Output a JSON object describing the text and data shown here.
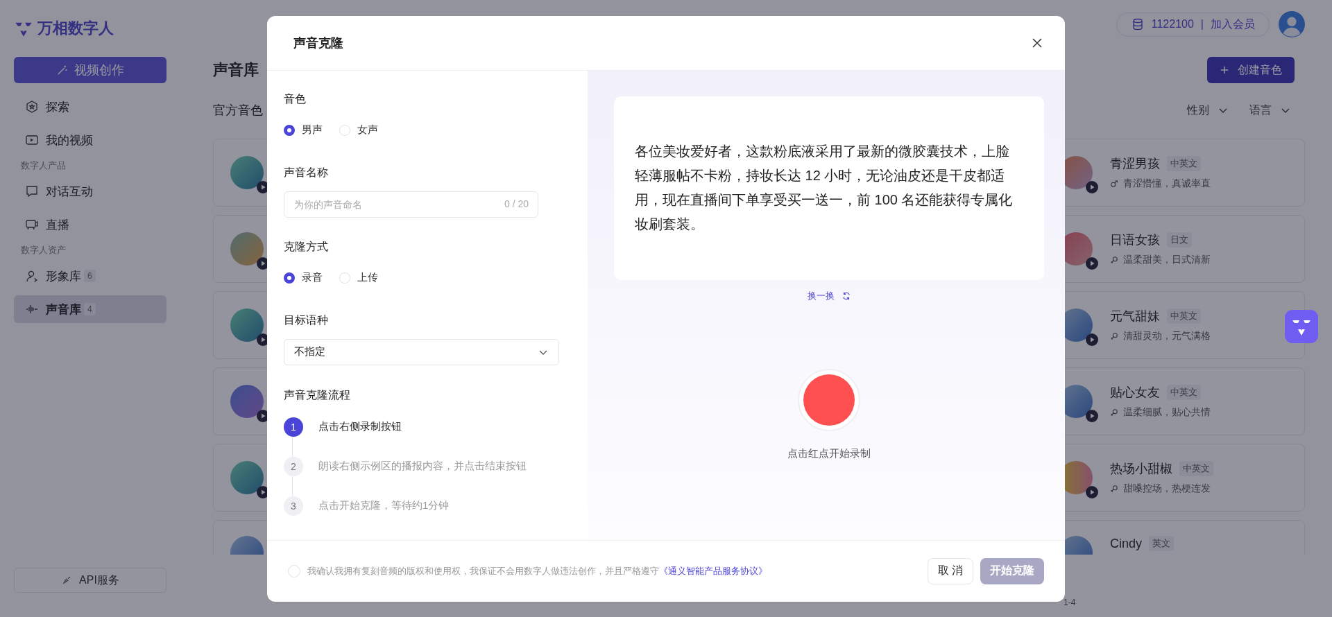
{
  "brand": {
    "name": "万相数字人"
  },
  "sidebar": {
    "create_button": "视频创作",
    "groups": [
      {
        "items": [
          {
            "label": "探索",
            "selected": false
          },
          {
            "label": "我的视频",
            "selected": false
          }
        ]
      },
      {
        "title": "数字人产品",
        "items": [
          {
            "label": "对话互动",
            "selected": false
          },
          {
            "label": "直播",
            "selected": false
          }
        ]
      },
      {
        "title": "数字人资产",
        "items": [
          {
            "label": "形象库",
            "badge": "6",
            "selected": false
          },
          {
            "label": "声音库",
            "badge": "4",
            "selected": true
          }
        ]
      }
    ],
    "api_button": "API服务"
  },
  "topbar": {
    "credits": "1122100",
    "separator": "|",
    "membership": "加入会员"
  },
  "page": {
    "title": "声音库",
    "create_button": "创建音色",
    "section": "官方音色",
    "filters": [
      "性别",
      "语言"
    ],
    "footer": "1-4"
  },
  "voice_cards_right": [
    {
      "name": "青涩男孩",
      "tag": "中英文",
      "kind": "male",
      "description": "青涩懵懂，真诚率直"
    },
    {
      "name": "日语女孩",
      "tag": "日文",
      "kind": "female",
      "description": "温柔甜美，日式清新"
    },
    {
      "name": "元气甜妹",
      "tag": "中英文",
      "kind": "female",
      "description": "清甜灵动，元气满格"
    },
    {
      "name": "贴心女友",
      "tag": "中英文",
      "kind": "female",
      "description": "温柔细腻，贴心共情"
    },
    {
      "name": "热场小甜椒",
      "tag": "中英文",
      "kind": "female",
      "description": "甜嗓控场，热梗连发"
    },
    {
      "name": "Cindy",
      "tag": "英文"
    }
  ],
  "dialog": {
    "title": "声音克隆",
    "timbre": {
      "label": "音色",
      "options": [
        {
          "label": "男声",
          "selected": true
        },
        {
          "label": "女声",
          "selected": false
        }
      ]
    },
    "voice_name": {
      "label": "声音名称",
      "placeholder": "为你的声音命名",
      "counter": "0 / 20"
    },
    "clone_method": {
      "label": "克隆方式",
      "options": [
        {
          "label": "录音",
          "selected": true
        },
        {
          "label": "上传",
          "selected": false
        }
      ]
    },
    "target_language": {
      "label": "目标语种",
      "value": "不指定"
    },
    "process": {
      "label": "声音克隆流程",
      "steps": [
        {
          "number": "1",
          "text": "点击右侧录制按钮",
          "active": true
        },
        {
          "number": "2",
          "text": "朗读右侧示例区的播报内容，并点击结束按钮",
          "active": false
        },
        {
          "number": "3",
          "text": "点击开始克隆，等待约1分钟",
          "active": false
        }
      ]
    },
    "sample_text": "各位美妆爱好者，这款粉底液采用了最新的微胶囊技术，上脸轻薄服帖不卡粉，持妆长达 12 小时，无论油皮还是干皮都适用，现在直播间下单享受买一送一，前 100 名还能获得专属化妆刷套装。",
    "refresh": "换一换",
    "record_hint": "点击红点开始录制",
    "agreement": {
      "checked": false,
      "text": "我确认我拥有复刻音频的版权和使用权，我保证不会用数字人做违法创作，并且严格遵守",
      "link": "《通义智能产品服务协议》"
    },
    "cancel_button": "取 消",
    "start_button": {
      "label": "开始克隆",
      "disabled": true
    }
  }
}
